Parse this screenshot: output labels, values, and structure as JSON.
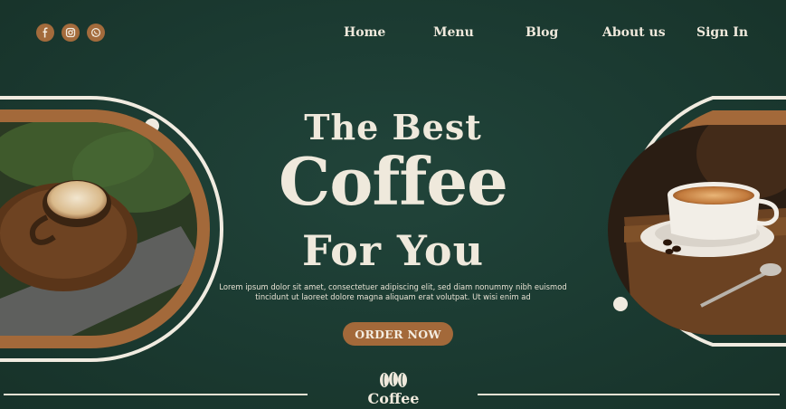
{
  "colors": {
    "background": "#1c3a30",
    "accent_brown": "#a3693a",
    "cream": "#efe9dc"
  },
  "social": [
    {
      "icon": "facebook-icon"
    },
    {
      "icon": "instagram-icon"
    },
    {
      "icon": "whatsapp-icon"
    }
  ],
  "nav": {
    "items": [
      "Home",
      "Menu",
      "Blog",
      "About us",
      "Sign In"
    ]
  },
  "hero": {
    "line1": "The Best",
    "line2": "Coffee",
    "line3": "For You",
    "description": "Lorem ipsum dolor sit amet, consectetuer adipiscing elit, sed diam nonummy nibh euismod tincidunt ut laoreet dolore magna aliquam erat volutpat. Ut wisi enim ad",
    "cta_label": "ORDER NOW"
  },
  "footer": {
    "brand": "Coffee",
    "logo_icon": "coffee-beans-icon"
  },
  "images": {
    "left": "latte-on-wooden-tray",
    "right": "espresso-cup-with-beans"
  }
}
